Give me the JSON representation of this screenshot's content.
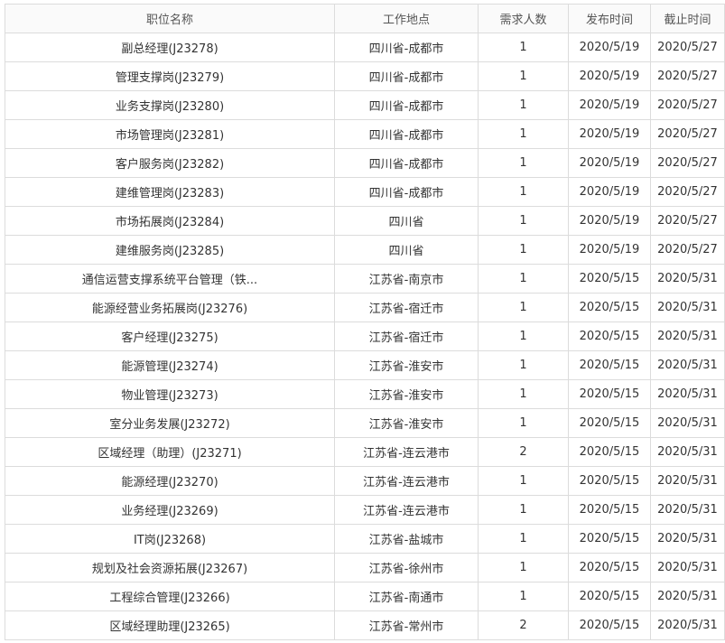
{
  "table": {
    "headers": {
      "title": "职位名称",
      "location": "工作地点",
      "count": "需求人数",
      "published": "发布时间",
      "deadline": "截止时间"
    },
    "rows": [
      {
        "title": "副总经理(J23278)",
        "location": "四川省-成都市",
        "count": "1",
        "published": "2020/5/19",
        "deadline": "2020/5/27"
      },
      {
        "title": "管理支撑岗(J23279)",
        "location": "四川省-成都市",
        "count": "1",
        "published": "2020/5/19",
        "deadline": "2020/5/27"
      },
      {
        "title": "业务支撑岗(J23280)",
        "location": "四川省-成都市",
        "count": "1",
        "published": "2020/5/19",
        "deadline": "2020/5/27"
      },
      {
        "title": "市场管理岗(J23281)",
        "location": "四川省-成都市",
        "count": "1",
        "published": "2020/5/19",
        "deadline": "2020/5/27"
      },
      {
        "title": "客户服务岗(J23282)",
        "location": "四川省-成都市",
        "count": "1",
        "published": "2020/5/19",
        "deadline": "2020/5/27"
      },
      {
        "title": "建维管理岗(J23283)",
        "location": "四川省-成都市",
        "count": "1",
        "published": "2020/5/19",
        "deadline": "2020/5/27"
      },
      {
        "title": "市场拓展岗(J23284)",
        "location": "四川省",
        "count": "1",
        "published": "2020/5/19",
        "deadline": "2020/5/27"
      },
      {
        "title": "建维服务岗(J23285)",
        "location": "四川省",
        "count": "1",
        "published": "2020/5/19",
        "deadline": "2020/5/27"
      },
      {
        "title": "通信运营支撑系统平台管理（铁...",
        "location": "江苏省-南京市",
        "count": "1",
        "published": "2020/5/15",
        "deadline": "2020/5/31"
      },
      {
        "title": "能源经营业务拓展岗(J23276)",
        "location": "江苏省-宿迁市",
        "count": "1",
        "published": "2020/5/15",
        "deadline": "2020/5/31"
      },
      {
        "title": "客户经理(J23275)",
        "location": "江苏省-宿迁市",
        "count": "1",
        "published": "2020/5/15",
        "deadline": "2020/5/31"
      },
      {
        "title": "能源管理(J23274)",
        "location": "江苏省-淮安市",
        "count": "1",
        "published": "2020/5/15",
        "deadline": "2020/5/31"
      },
      {
        "title": "物业管理(J23273)",
        "location": "江苏省-淮安市",
        "count": "1",
        "published": "2020/5/15",
        "deadline": "2020/5/31"
      },
      {
        "title": "室分业务发展(J23272)",
        "location": "江苏省-淮安市",
        "count": "1",
        "published": "2020/5/15",
        "deadline": "2020/5/31"
      },
      {
        "title": "区域经理（助理）(J23271)",
        "location": "江苏省-连云港市",
        "count": "2",
        "published": "2020/5/15",
        "deadline": "2020/5/31"
      },
      {
        "title": "能源经理(J23270)",
        "location": "江苏省-连云港市",
        "count": "1",
        "published": "2020/5/15",
        "deadline": "2020/5/31"
      },
      {
        "title": "业务经理(J23269)",
        "location": "江苏省-连云港市",
        "count": "1",
        "published": "2020/5/15",
        "deadline": "2020/5/31"
      },
      {
        "title": "IT岗(J23268)",
        "location": "江苏省-盐城市",
        "count": "1",
        "published": "2020/5/15",
        "deadline": "2020/5/31"
      },
      {
        "title": "规划及社会资源拓展(J23267)",
        "location": "江苏省-徐州市",
        "count": "1",
        "published": "2020/5/15",
        "deadline": "2020/5/31"
      },
      {
        "title": "工程综合管理(J23266)",
        "location": "江苏省-南通市",
        "count": "1",
        "published": "2020/5/15",
        "deadline": "2020/5/31"
      },
      {
        "title": "区域经理助理(J23265)",
        "location": "江苏省-常州市",
        "count": "2",
        "published": "2020/5/15",
        "deadline": "2020/5/31"
      }
    ]
  }
}
